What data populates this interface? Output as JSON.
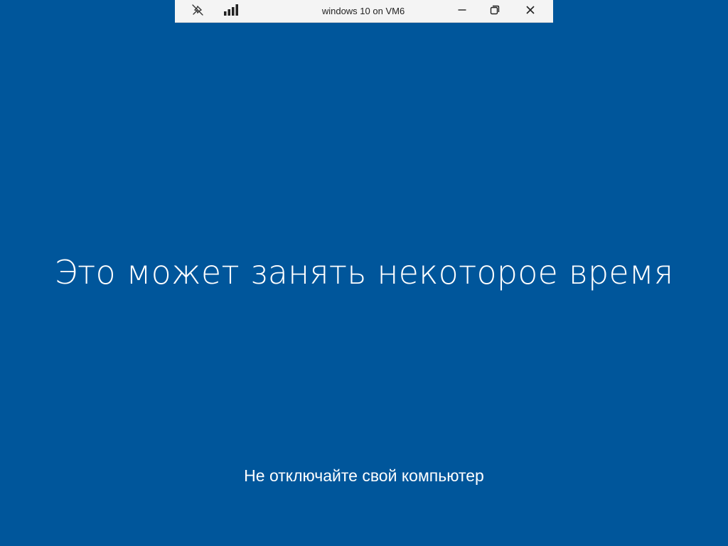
{
  "rdp_bar": {
    "title": "windows 10 on VM6",
    "icons": {
      "pin": "unpin-icon",
      "connection": "signal-bars-icon",
      "minimize": "minimize-icon",
      "restore": "restore-icon",
      "close": "close-icon"
    }
  },
  "screen": {
    "headline": "Это может занять некоторое время",
    "subtext": "Не отключайте свой компьютер",
    "background_color": "#00569b",
    "text_color": "#ffffff"
  }
}
